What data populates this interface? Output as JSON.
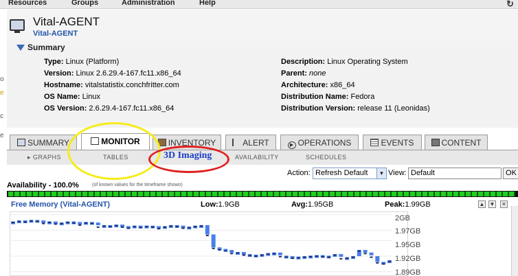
{
  "menu": {
    "items": [
      "Resources",
      "Groups",
      "Administration",
      "Help"
    ]
  },
  "left_strip": [
    "o",
    "e",
    "c",
    "e"
  ],
  "resource": {
    "title": "Vital-AGENT",
    "subtitle": "Vital-AGENT"
  },
  "summary": {
    "heading": "Summary",
    "left": [
      {
        "label": "Type:",
        "value": "Linux (Platform)"
      },
      {
        "label": "Version:",
        "value": "Linux 2.6.29.4-167.fc11.x86_64"
      },
      {
        "label": "Hostname:",
        "value": "vitalstatistix.conchfritter.com"
      },
      {
        "label": "OS Name:",
        "value": "Linux"
      },
      {
        "label": "OS Version:",
        "value": "2.6.29.4-167.fc11.x86_64"
      }
    ],
    "right": [
      {
        "label": "Description:",
        "value": "Linux Operating System"
      },
      {
        "label": "Parent:",
        "value": "none"
      },
      {
        "label": "Architecture:",
        "value": "x86_64"
      },
      {
        "label": "Distribution Name:",
        "value": "Fedora"
      },
      {
        "label": "Distribution Version:",
        "value": "release 11 (Leonidas)"
      }
    ]
  },
  "tabs": [
    {
      "label": "SUMMARY",
      "icon": "monitor-icon"
    },
    {
      "label": "MONITOR",
      "icon": "chart-icon",
      "active": true
    },
    {
      "label": "INVENTORY",
      "icon": "box-icon"
    },
    {
      "label": "ALERT",
      "icon": "flag-icon"
    },
    {
      "label": "OPERATIONS",
      "icon": "play-icon"
    },
    {
      "label": "EVENTS",
      "icon": "calendar-icon"
    },
    {
      "label": "CONTENT",
      "icon": "package-icon"
    }
  ],
  "subtabs": [
    "GRAPHS",
    "TABLES",
    "AVAILABILITY",
    "SCHEDULES"
  ],
  "annotation": {
    "text": "3D Imaging",
    "yellow": "#f5ec1a",
    "red": "#e02020"
  },
  "action_row": {
    "action_label": "Action:",
    "action_value": "Refresh Default",
    "view_label": "View:",
    "view_value": "Default",
    "ok_label": "OK"
  },
  "availability": {
    "label": "Availability - 100.0%",
    "note": "(of known values for the timeframe shown)",
    "percent": 100
  },
  "chart_data": {
    "type": "line",
    "title": "Free Memory (Vital-AGENT)",
    "low": "Low:1.9GB",
    "avg": "Avg:1.95GB",
    "peak": "Peak:1.99GB",
    "yticks": [
      "2GB",
      "1.97GB",
      "1.95GB",
      "1.92GB",
      "1.89GB"
    ],
    "ylim": [
      1.883,
      2.005
    ],
    "series": [
      {
        "values": [
          1.985,
          1.987,
          1.986,
          1.988,
          1.987,
          1.983,
          1.985,
          1.982,
          1.983,
          1.985,
          1.984,
          1.98,
          1.984,
          1.983,
          1.976,
          1.978,
          1.977,
          1.979,
          1.976,
          1.974,
          1.977,
          1.975,
          1.977,
          1.976,
          1.973,
          1.976,
          1.978,
          1.977,
          1.974,
          1.975,
          1.977,
          1.978,
          1.96,
          1.935,
          1.932,
          1.93,
          1.925,
          1.926,
          1.922,
          1.921,
          1.92,
          1.922,
          1.924,
          1.925,
          1.919,
          1.918,
          1.916,
          1.917,
          1.918,
          1.919,
          1.92,
          1.919,
          1.918,
          1.922,
          1.915,
          1.916,
          1.918,
          1.93,
          1.925,
          1.918,
          1.907,
          1.905,
          1.91
        ]
      }
    ]
  },
  "colors": {
    "accent": "#2255aa",
    "bar": "#4a7fe8",
    "availability": "#22cc22"
  }
}
